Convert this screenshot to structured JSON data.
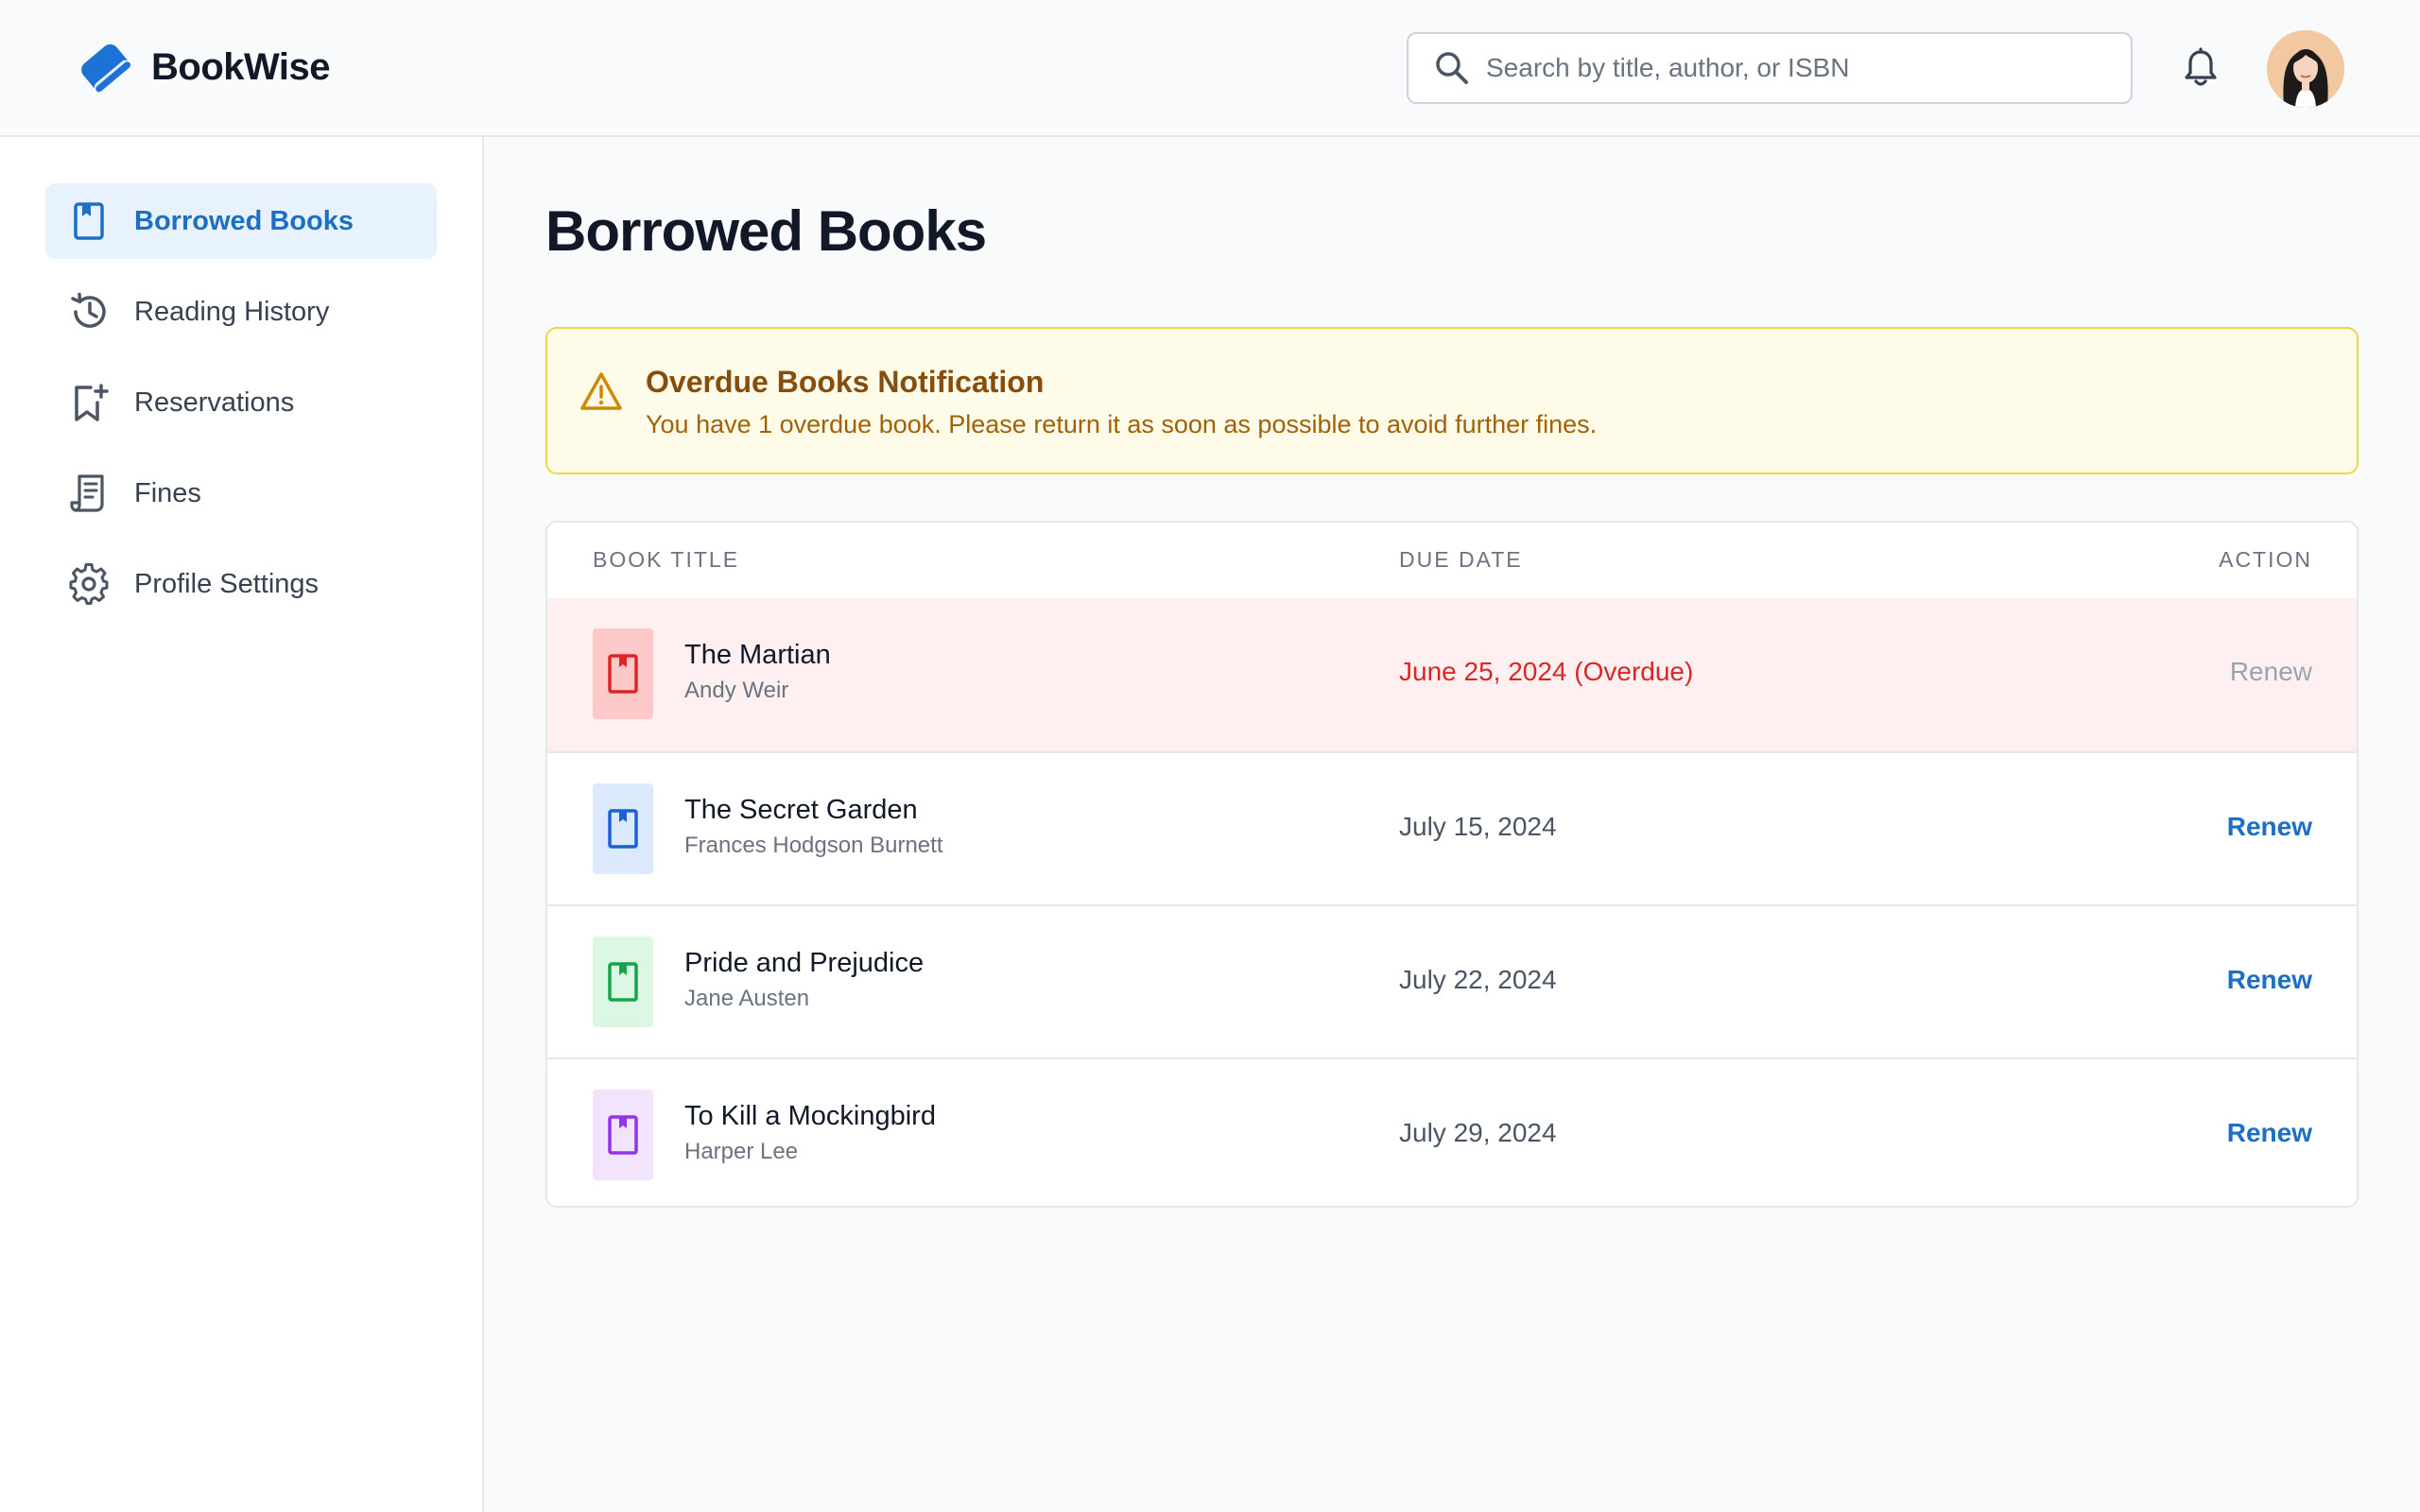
{
  "app": {
    "name": "BookWise",
    "logo_icon": "book-logo-icon",
    "brand_color": "#1d72d6"
  },
  "header": {
    "search": {
      "placeholder": "Search by title, author, or ISBN",
      "value": "",
      "icon": "search-icon"
    },
    "notification_icon": "bell-icon",
    "avatar_icon": "user-avatar"
  },
  "sidebar": {
    "items": [
      {
        "label": "Borrowed Books",
        "icon": "book-icon",
        "active": true
      },
      {
        "label": "Reading History",
        "icon": "history-icon",
        "active": false
      },
      {
        "label": "Reservations",
        "icon": "bookmark-add-icon",
        "active": false
      },
      {
        "label": "Fines",
        "icon": "receipt-icon",
        "active": false
      },
      {
        "label": "Profile Settings",
        "icon": "gear-icon",
        "active": false
      }
    ]
  },
  "main": {
    "title": "Borrowed Books",
    "alert": {
      "icon": "warning-icon",
      "title": "Overdue Books Notification",
      "message": "You have 1 overdue book. Please return it as soon as possible to avoid further fines."
    },
    "table": {
      "headers": {
        "title": "BOOK TITLE",
        "due": "DUE DATE",
        "action": "ACTION"
      },
      "rows": [
        {
          "title": "The Martian",
          "author": "Andy Weir",
          "due": "June 25, 2024 (Overdue)",
          "action": "Renew",
          "overdue": true,
          "cover_bg": "#fcc8c8",
          "cover_color": "#dc2626"
        },
        {
          "title": "The Secret Garden",
          "author": "Frances Hodgson Burnett",
          "due": "July 15, 2024",
          "action": "Renew",
          "overdue": false,
          "cover_bg": "#dbe9fc",
          "cover_color": "#1d5fd6"
        },
        {
          "title": "Pride and Prejudice",
          "author": "Jane Austen",
          "due": "July 22, 2024",
          "action": "Renew",
          "overdue": false,
          "cover_bg": "#dcf7e3",
          "cover_color": "#16a34a"
        },
        {
          "title": "To Kill a Mockingbird",
          "author": "Harper Lee",
          "due": "July 29, 2024",
          "action": "Renew",
          "overdue": false,
          "cover_bg": "#f1e4fc",
          "cover_color": "#9333ea"
        }
      ]
    }
  }
}
